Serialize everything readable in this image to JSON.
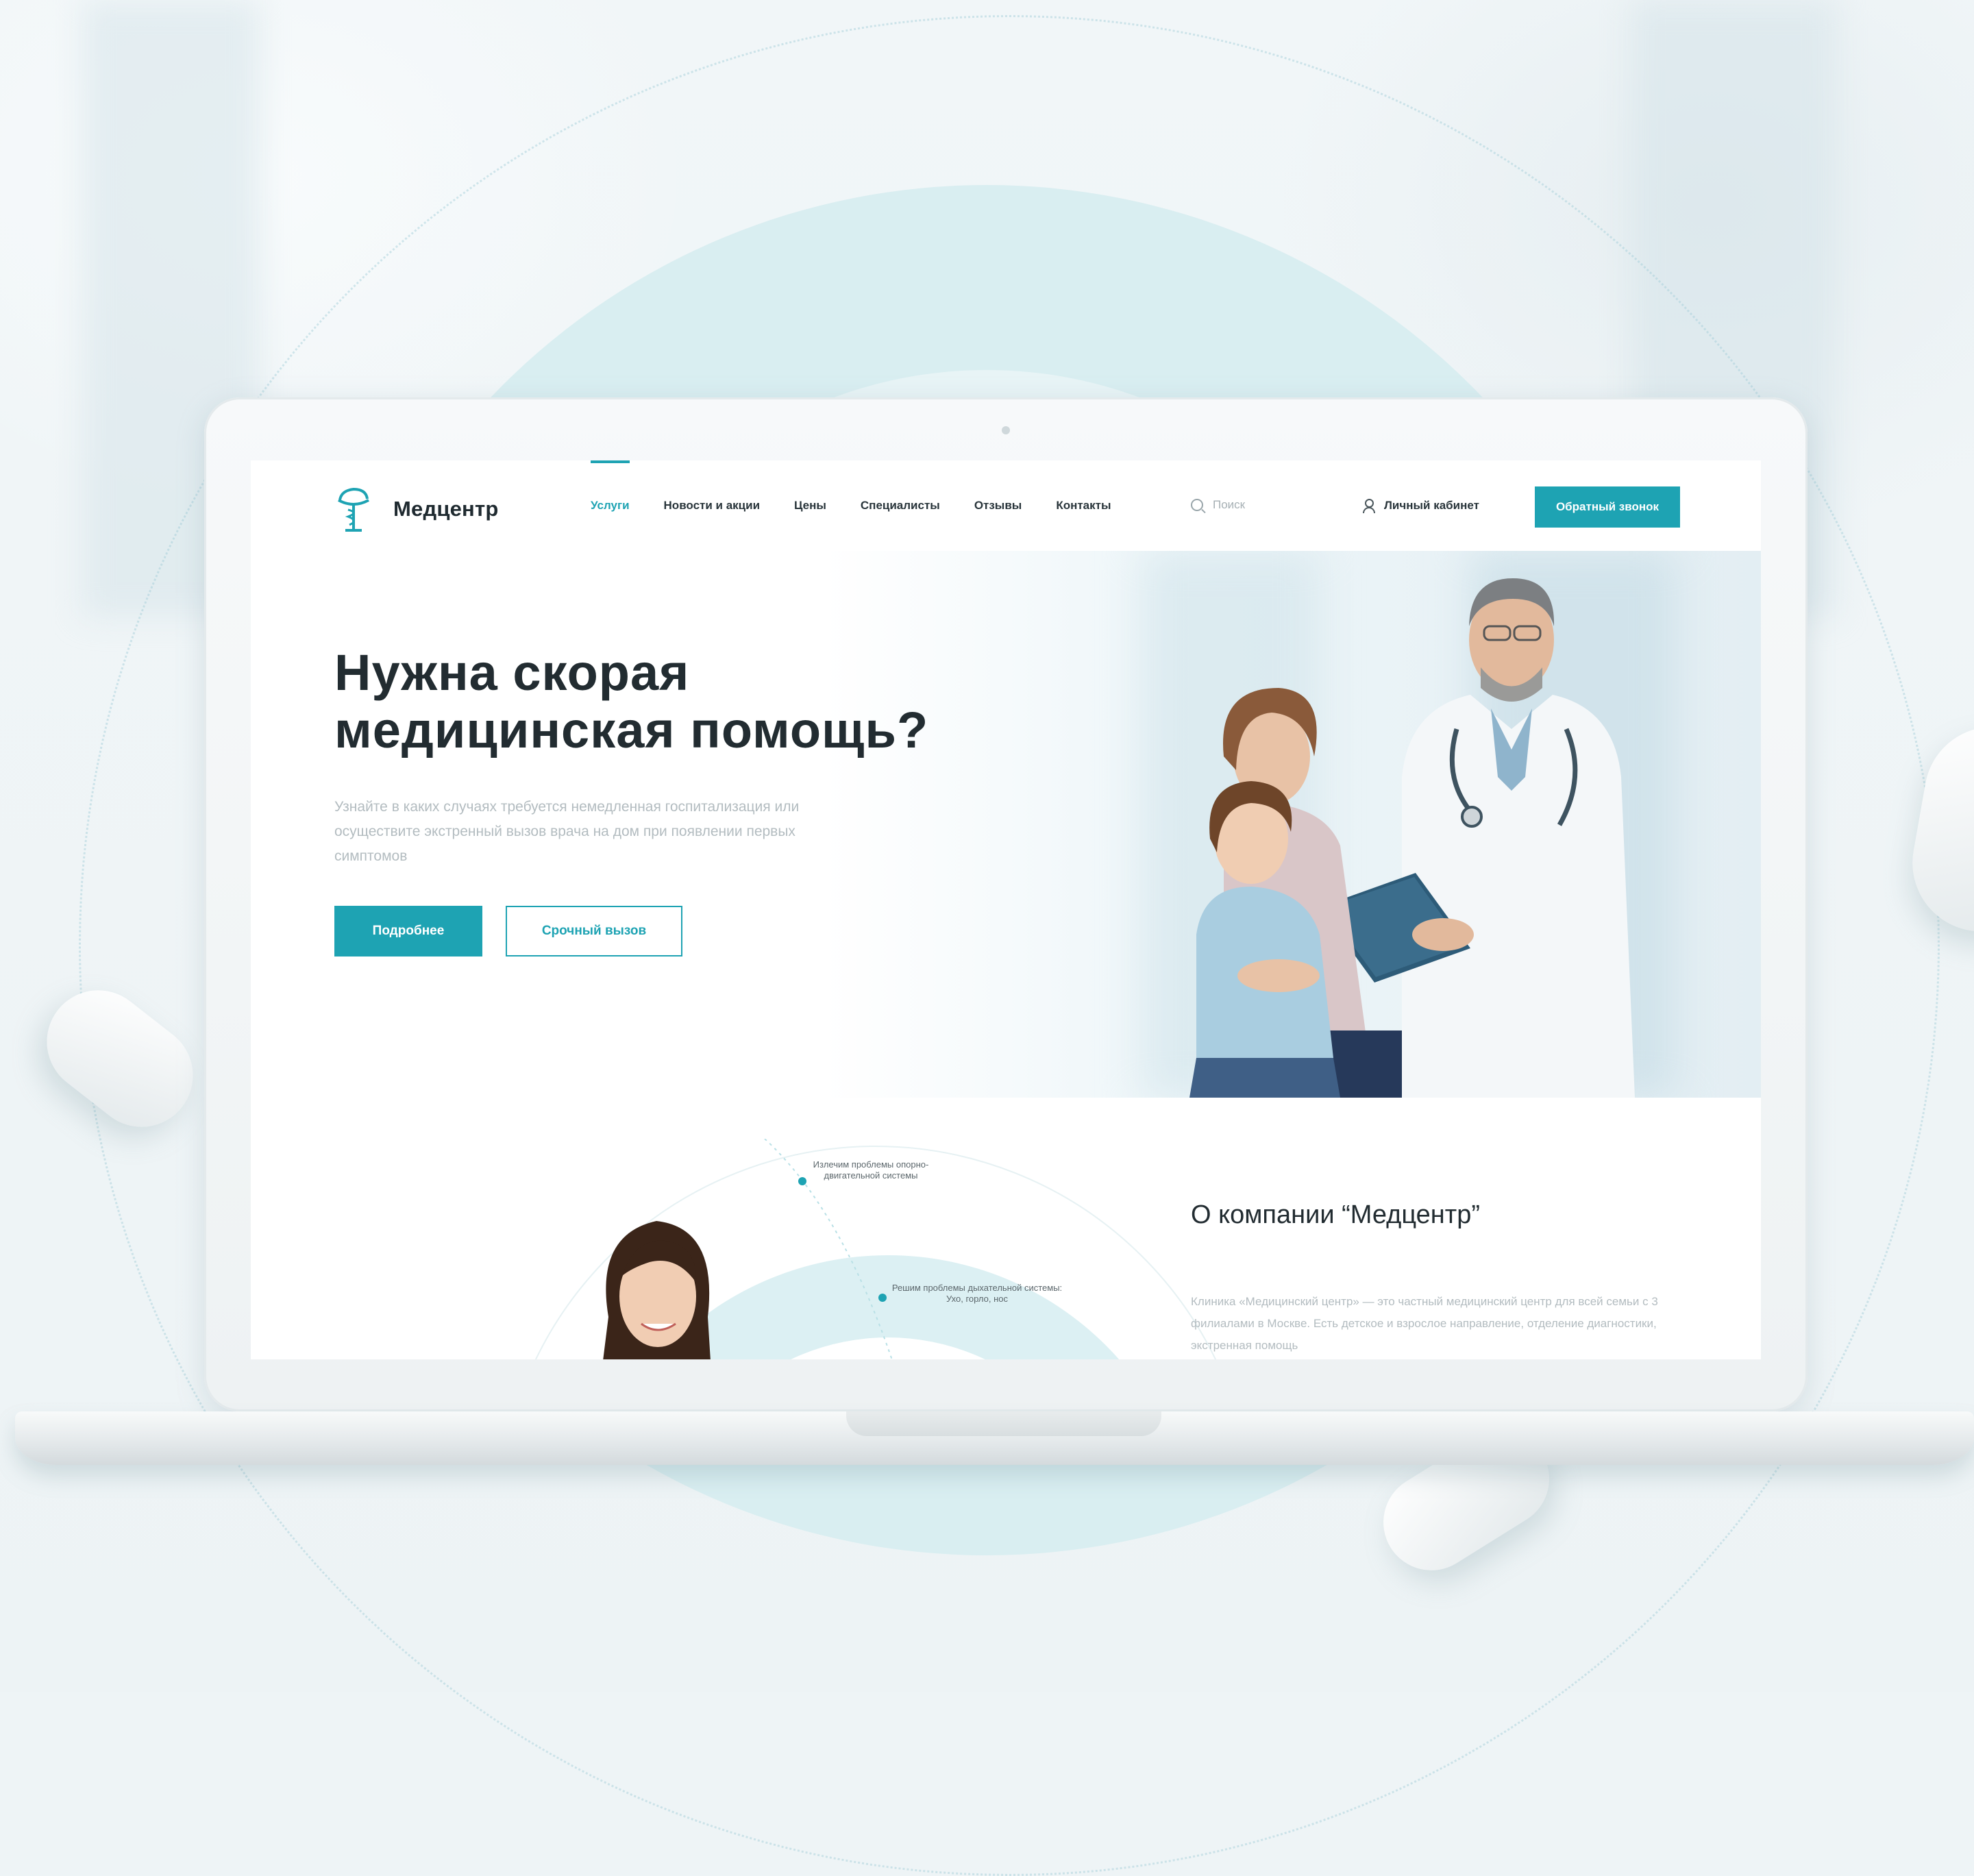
{
  "brand": {
    "name": "Медцентр",
    "accent_color": "#1ea3b3"
  },
  "header": {
    "nav": [
      {
        "label": "Услуги",
        "active": true
      },
      {
        "label": "Новости и акции",
        "active": false
      },
      {
        "label": "Цены",
        "active": false
      },
      {
        "label": "Специалисты",
        "active": false
      },
      {
        "label": "Отзывы",
        "active": false
      },
      {
        "label": "Контакты",
        "active": false
      }
    ],
    "search_placeholder": "Поиск",
    "account_label": "Личный кабинет",
    "callback_label": "Обратный звонок"
  },
  "hero": {
    "title_line1": "Нужна скорая",
    "title_line2": "медицинская помощь?",
    "description": "Узнайте в каких случаях требуется немедленная госпитализация или осуществите экстренный вызов врача на дом при появлении первых симптомов",
    "primary_button": "Подробнее",
    "secondary_button": "Срочный вызов"
  },
  "about": {
    "feature_1": "Излечим проблемы опорно-двигательной системы",
    "feature_2": "Решим проблемы дыхательной системы: Ухо, горло, нос",
    "title": "О компании “Медцентр”",
    "text": "Клиника «Медицинский центр» — это частный медицинский центр для всей семьи с 3 филиалами в Москве. Есть детское и взрослое направление, отделение диагностики, экстренная помощь"
  }
}
